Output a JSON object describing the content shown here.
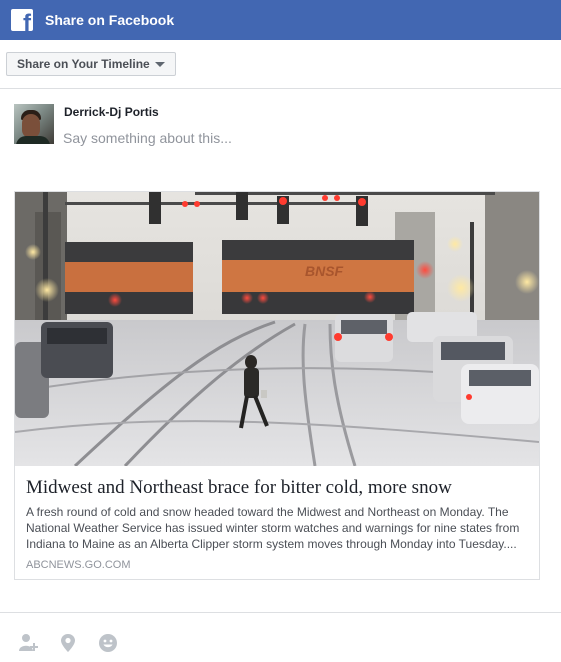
{
  "header": {
    "title": "Share on Facebook",
    "logo": "facebook-f-icon",
    "color": "#4267b2"
  },
  "destination": {
    "label": "Share on Your Timeline",
    "caret": "chevron-down-icon"
  },
  "composer": {
    "user_name": "Derrick-Dj Portis",
    "placeholder": "Say something about this...",
    "value": ""
  },
  "link_card": {
    "title": "Midwest and Northeast brace for bitter cold, more snow",
    "description": "A fresh round of cold and snow headed toward the Midwest and Northeast on Monday. The National Weather Service has issued winter storm watches and warnings for nine states from Indiana to Maine as an Alberta Clipper storm system moves through Monday into Tuesday....",
    "domain": "ABCNEWS.GO.COM",
    "train_lettering": "BNSF"
  },
  "toolbar": {
    "icons": [
      "tag-people-icon",
      "location-pin-icon",
      "feeling-smiley-icon"
    ]
  }
}
